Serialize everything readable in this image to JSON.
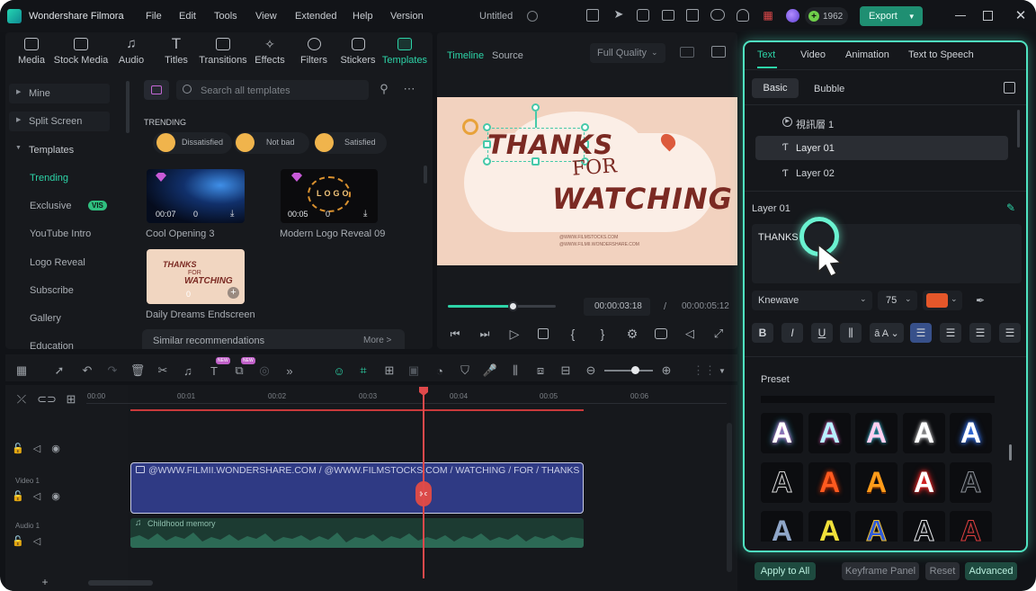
{
  "app": {
    "name": "Wondershare Filmora",
    "menu": [
      "File",
      "Edit",
      "Tools",
      "View",
      "Extended",
      "Help",
      "Version"
    ],
    "project_title": "Untitled",
    "credits": "1962",
    "export_label": "Export"
  },
  "media_tabs": [
    "Media",
    "Stock Media",
    "Audio",
    "Titles",
    "Transitions",
    "Effects",
    "Filters",
    "Stickers",
    "Templates"
  ],
  "sidebar": {
    "items": [
      {
        "label": "Mine"
      },
      {
        "label": "Split Screen"
      },
      {
        "label": "Templates"
      },
      {
        "label": "Trending"
      },
      {
        "label": "Exclusive",
        "badge": "VIS"
      },
      {
        "label": "YouTube Intro"
      },
      {
        "label": "Logo Reveal"
      },
      {
        "label": "Subscribe"
      },
      {
        "label": "Gallery"
      },
      {
        "label": "Education"
      }
    ]
  },
  "templates": {
    "search_placeholder": "Search all templates",
    "section": "TRENDING",
    "moods": [
      "Dissatisfied",
      "Not bad",
      "Satisfied"
    ],
    "cards": [
      {
        "title": "Cool Opening 3",
        "duration": "00:07",
        "count": "0"
      },
      {
        "title": "Modern Logo Reveal 09",
        "duration": "00:05",
        "count": "0",
        "logo_text": "LOGO"
      },
      {
        "title": "Daily Dreams Endscreen",
        "count": "0",
        "line1": "THANKS",
        "line2": "FOR",
        "line3": "WATCHING"
      }
    ],
    "similar": "Similar recommendations",
    "more": "More >"
  },
  "preview": {
    "tab_timeline": "Timeline",
    "tab_source": "Source",
    "quality": "Full Quality",
    "canvas_line1": "THANKS",
    "canvas_line2": "FOR",
    "canvas_line3": "WATCHING",
    "small_line1": "@WWW.FILMSTOCKS.COM",
    "small_line2": "@WWW.FILMII.WONDERSHARE.COM",
    "current_time": "00:00:03:18",
    "separator": "/",
    "total_time": "00:00:05:12",
    "progress": 0.6
  },
  "timeline": {
    "ruler": [
      "00:00",
      "00:01",
      "00:02",
      "00:03",
      "00:04",
      "00:05",
      "00:06"
    ],
    "new_badge": "NEW",
    "track_video": "Video 1",
    "track_audio": "Audio 1",
    "clip_text": "@WWW.FILMII.WONDERSHARE.COM / @WWW.FILMSTOCKS.COM / WATCHING / FOR / THANKS",
    "audio_clip": "Childhood memory"
  },
  "right_panel": {
    "tabs": [
      "Text",
      "Video",
      "Animation",
      "Text to Speech"
    ],
    "subtabs": [
      "Basic",
      "Bubble"
    ],
    "layers": [
      "視訊層 1",
      "Layer 01",
      "Layer 02"
    ],
    "layer_title": "Layer 01",
    "text_value": "THANKS",
    "font": "Knewave",
    "size": "75",
    "color": "#e5572a",
    "preset_label": "Preset",
    "footer": {
      "apply_all": "Apply to All",
      "keyframe": "Keyframe Panel",
      "reset": "Reset",
      "advanced": "Advanced"
    }
  },
  "colors": {
    "accent": "#2dd4a8",
    "panel_glow": "#4fe3c1",
    "playhead": "#e0494b"
  }
}
